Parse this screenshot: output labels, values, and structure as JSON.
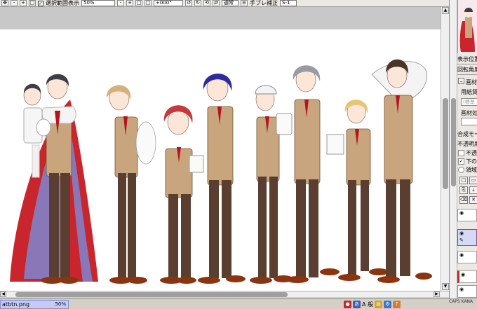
{
  "toolbar": {
    "checkbox_checked": "✓",
    "selection_display_label": "選択範囲表示",
    "zoom_value": "50%",
    "rotation_value": "+000°",
    "blend_mode": "通常",
    "stabilizer_label": "手ブレ補正",
    "stabilizer_value": "S-1"
  },
  "right_panel": {
    "display_position_label": "表示位置",
    "rotation_angle_label": "回転角度",
    "material_label": "画材効",
    "paper_quality_label": "用紙質",
    "paper_value": "(標準",
    "material2_label": "画材効",
    "composite_mode_label": "合成モー",
    "opacity_label": "不透明度",
    "protect_opacity_label": "不透明",
    "clip_lower_label": "下のレ",
    "selection_source_label": "領域検",
    "clip_lower_checked": "✓"
  },
  "status": {
    "file_name": "atbtn.png",
    "file_zoom": "50%",
    "ime_text": "A 般",
    "clock": "CAPS KANA"
  },
  "colors": {
    "toolbar_bg": "#ece9e4",
    "canvas_bg": "#c8c8c8",
    "paper": "#ffffff",
    "jacket": "#c9a57e",
    "trousers": "#5a3e30",
    "shoes": "#8a3510",
    "tie": "#b4141e",
    "cape_red": "#c8262c",
    "cape_lining": "#8878b8",
    "active_tab": "#c5cbf2"
  }
}
